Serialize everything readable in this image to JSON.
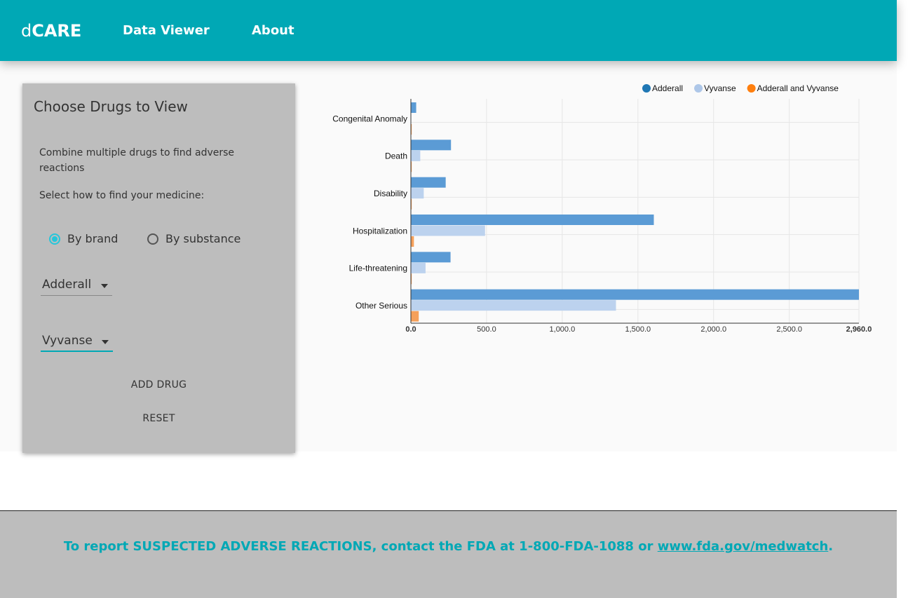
{
  "header": {
    "logo_prefix": "d",
    "logo_main": "CARE",
    "nav": [
      "Data Viewer",
      "About"
    ]
  },
  "panel": {
    "title": "Choose Drugs to View",
    "description": "Combine multiple drugs to find adverse reactions",
    "how_label": "Select how to find your medicine:",
    "radio_options": [
      {
        "label": "By brand",
        "selected": true
      },
      {
        "label": "By substance",
        "selected": false
      }
    ],
    "drug_selects": [
      "Adderall",
      "Vyvanse"
    ],
    "add_drug_label": "ADD DRUG",
    "reset_label": "RESET"
  },
  "footer": {
    "message": "To report SUSPECTED ADVERSE REACTIONS, contact the FDA at 1-800-FDA-1088 or ",
    "link_text": "www.fda.gov/medwatch",
    "end_punct": "."
  },
  "chart_data": {
    "type": "bar",
    "orientation": "horizontal",
    "categories": [
      "Congenital Anomaly",
      "Death",
      "Disability",
      "Hospitalization",
      "Life-threatening",
      "Other Serious"
    ],
    "series": [
      {
        "name": "Adderall",
        "color": "#5b9bd5",
        "legend_color": "#1f77b4",
        "values": [
          35,
          265,
          230,
          1605,
          262,
          2960
        ]
      },
      {
        "name": "Vyvanse",
        "color": "#bcd2ee",
        "legend_color": "#aec7e8",
        "values": [
          0,
          62,
          85,
          490,
          97,
          1355
        ]
      },
      {
        "name": "Adderall and Vyvanse",
        "color": "#f5a05a",
        "legend_color": "#ff7f0e",
        "values": [
          4,
          4,
          4,
          20,
          4,
          52
        ]
      }
    ],
    "x_ticks": [
      "0.0",
      "500.0",
      "1,000.0",
      "1,500.0",
      "2,000.0",
      "2,500.0",
      "2,960.0"
    ],
    "x_tick_values": [
      0,
      500,
      1000,
      1500,
      2000,
      2500,
      2960
    ],
    "xlim": [
      0,
      2960
    ],
    "grid": true,
    "legend_position": "top-right"
  }
}
